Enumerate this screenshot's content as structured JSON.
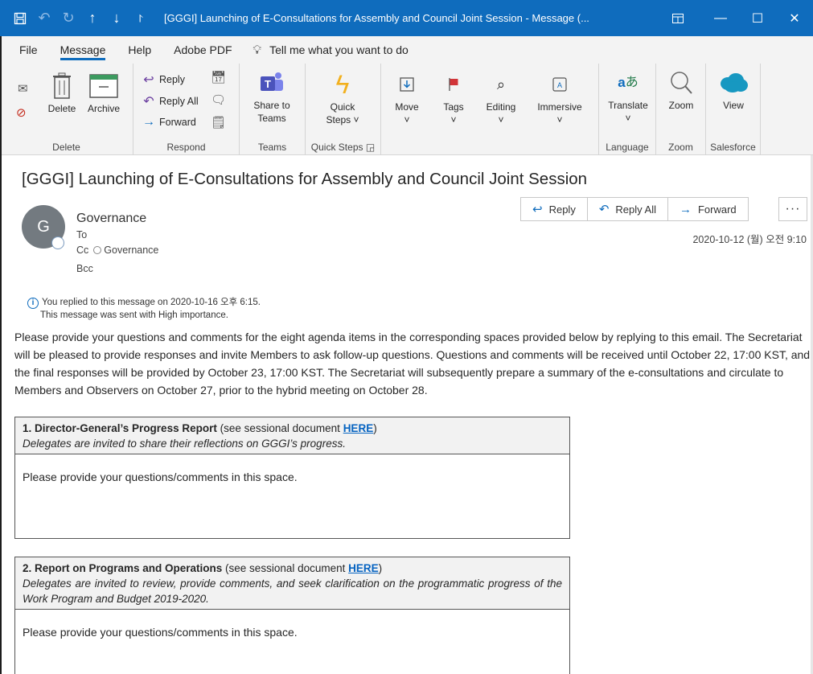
{
  "titlebar": {
    "title": "[GGGI] Launching of E-Consultations for Assembly and Council Joint Session  -  Message (...",
    "save_icon": "save-icon",
    "window_controls": [
      "restore",
      "minimize",
      "maximize",
      "close"
    ]
  },
  "tabs": {
    "file": "File",
    "message": "Message",
    "help": "Help",
    "adobe": "Adobe PDF",
    "tellme": "Tell me what you want to do"
  },
  "ribbon": {
    "delete": "Delete",
    "archive": "Archive",
    "group_delete": "Delete",
    "reply": "Reply",
    "reply_all": "Reply All",
    "forward": "Forward",
    "group_respond": "Respond",
    "share_teams_1": "Share to",
    "share_teams_2": "Teams",
    "group_teams": "Teams",
    "quick_steps_1": "Quick",
    "quick_steps_2": "Steps ˅",
    "group_quick_steps": "Quick Steps",
    "move": "Move",
    "tags": "Tags",
    "editing": "Editing",
    "immersive": "Immersive",
    "translate": "Translate",
    "group_language": "Language",
    "zoom": "Zoom",
    "group_zoom": "Zoom",
    "view": "View",
    "group_salesforce": "Salesforce"
  },
  "message": {
    "subject": "[GGGI] Launching of E-Consultations for Assembly and Council Joint Session",
    "avatar_initial": "G",
    "sender": "Governance",
    "to_label": "To",
    "cc_label": "Cc",
    "cc_value": "Governance",
    "bcc_label": "Bcc",
    "reply_btn": "Reply",
    "reply_all_btn": "Reply All",
    "forward_btn": "Forward",
    "more_btn": "···",
    "date": "2020-10-12 (월) 오전 9:10",
    "info_line1": "You replied to this message on 2020-10-16 오후 6:15.",
    "info_line2": "This message was sent with High importance.",
    "body": "Please provide your questions and comments for the eight agenda items in the corresponding spaces provided below by replying to this email. The Secretariat will be pleased to provide responses and invite Members to ask follow-up questions. Questions and comments will be received until October 22, 17:00 KST, and the final responses will be provided by October 23, 17:00 KST. The Secretariat will subsequently prepare a summary of the e-consultations and circulate to Members and Observers on October 27, prior to the hybrid meeting on October 28."
  },
  "agenda": [
    {
      "title": "1. Director-General’s Progress Report",
      "see_text": " (see sessional document ",
      "link": "HERE",
      "close": ")",
      "desc": "Delegates are invited to share their reflections on GGGI’s progress.",
      "placeholder": "Please provide your questions/comments in this space."
    },
    {
      "title": "2. Report on Programs and Operations",
      "see_text": " (see sessional document ",
      "link": "HERE",
      "close": ")",
      "desc": "Delegates are invited to review, provide comments, and seek clarification on the programmatic progress of the Work Program and Budget 2019-2020.",
      "placeholder": "Please provide your questions/comments in this space."
    }
  ]
}
